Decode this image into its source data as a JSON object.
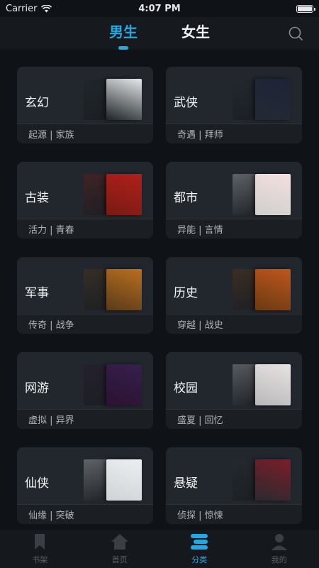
{
  "status": {
    "carrier": "Carrier",
    "time": "4:07 PM"
  },
  "tabs": [
    {
      "label": "男生",
      "active": true
    },
    {
      "label": "女生",
      "active": false
    }
  ],
  "categories": [
    {
      "title": "玄幻",
      "tags": "起源 | 家族",
      "colors": [
        "#1d2327",
        "#e6e9ea"
      ]
    },
    {
      "title": "武侠",
      "tags": "奇遇 | 拜师",
      "colors": [
        "#232933",
        "#1e2438"
      ]
    },
    {
      "title": "古装",
      "tags": "活力 | 青春",
      "colors": [
        "#7a1a14",
        "#b0201a"
      ]
    },
    {
      "title": "都市",
      "tags": "异能 | 言情",
      "colors": [
        "#cfcfcf",
        "#f2e0dc"
      ]
    },
    {
      "title": "军事",
      "tags": "传奇 | 战争",
      "colors": [
        "#5a3a1a",
        "#b8701f"
      ]
    },
    {
      "title": "历史",
      "tags": "穿越 | 战史",
      "colors": [
        "#6a3a12",
        "#c0561d"
      ]
    },
    {
      "title": "网游",
      "tags": "虚拟 | 异界",
      "colors": [
        "#2b1230",
        "#35204d"
      ]
    },
    {
      "title": "校园",
      "tags": "盛夏 | 回忆",
      "colors": [
        "#b9b9b9",
        "#e8e2e2"
      ]
    },
    {
      "title": "仙侠",
      "tags": "仙缘 | 突破",
      "colors": [
        "#cfd3d6",
        "#eceff1"
      ]
    },
    {
      "title": "悬疑",
      "tags": "侦探 | 惊悚",
      "colors": [
        "#2a2a2e",
        "#7b1d2a"
      ]
    }
  ],
  "bottom_nav": [
    {
      "label": "书架",
      "icon": "bookmark-icon",
      "active": false
    },
    {
      "label": "首页",
      "icon": "home-icon",
      "active": false
    },
    {
      "label": "分类",
      "icon": "category-icon",
      "active": true
    },
    {
      "label": "我的",
      "icon": "profile-icon",
      "active": false
    }
  ],
  "accent_color": "#23a8e3"
}
